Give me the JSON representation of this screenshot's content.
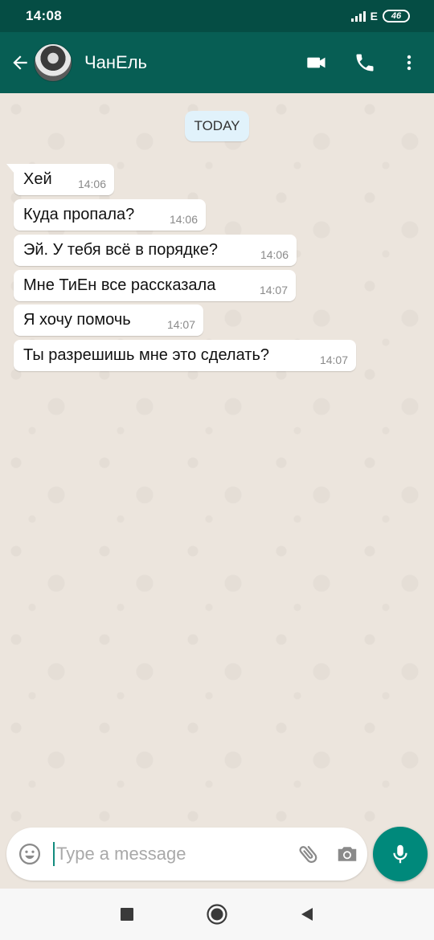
{
  "status_bar": {
    "time": "14:08",
    "network": "E",
    "battery": "46"
  },
  "header": {
    "contact_name": "ЧанЕль"
  },
  "chat": {
    "date_label": "TODAY",
    "messages": [
      {
        "text": "Хей",
        "time": "14:06"
      },
      {
        "text": "Куда пропала?",
        "time": "14:06"
      },
      {
        "text": "Эй. У тебя всё в порядке?",
        "time": "14:06"
      },
      {
        "text": "Мне ТиЕн все рассказала",
        "time": "14:07"
      },
      {
        "text": "Я хочу помочь",
        "time": "14:07"
      },
      {
        "text": "Ты разрешишь мне это сделать?",
        "time": "14:07"
      }
    ]
  },
  "input": {
    "placeholder": "Type a message",
    "value": ""
  },
  "icons": {
    "back": "arrow-left-icon",
    "video": "video-camera-icon",
    "call": "phone-icon",
    "menu": "more-vertical-icon",
    "emoji": "emoji-icon",
    "attach": "paperclip-icon",
    "camera": "camera-icon",
    "mic": "microphone-icon"
  },
  "colors": {
    "header": "#075e54",
    "status_bar": "#054d44",
    "accent": "#00897b",
    "chat_background": "#ece5dd",
    "date_chip": "#e1f2fb",
    "bubble": "#ffffff"
  }
}
